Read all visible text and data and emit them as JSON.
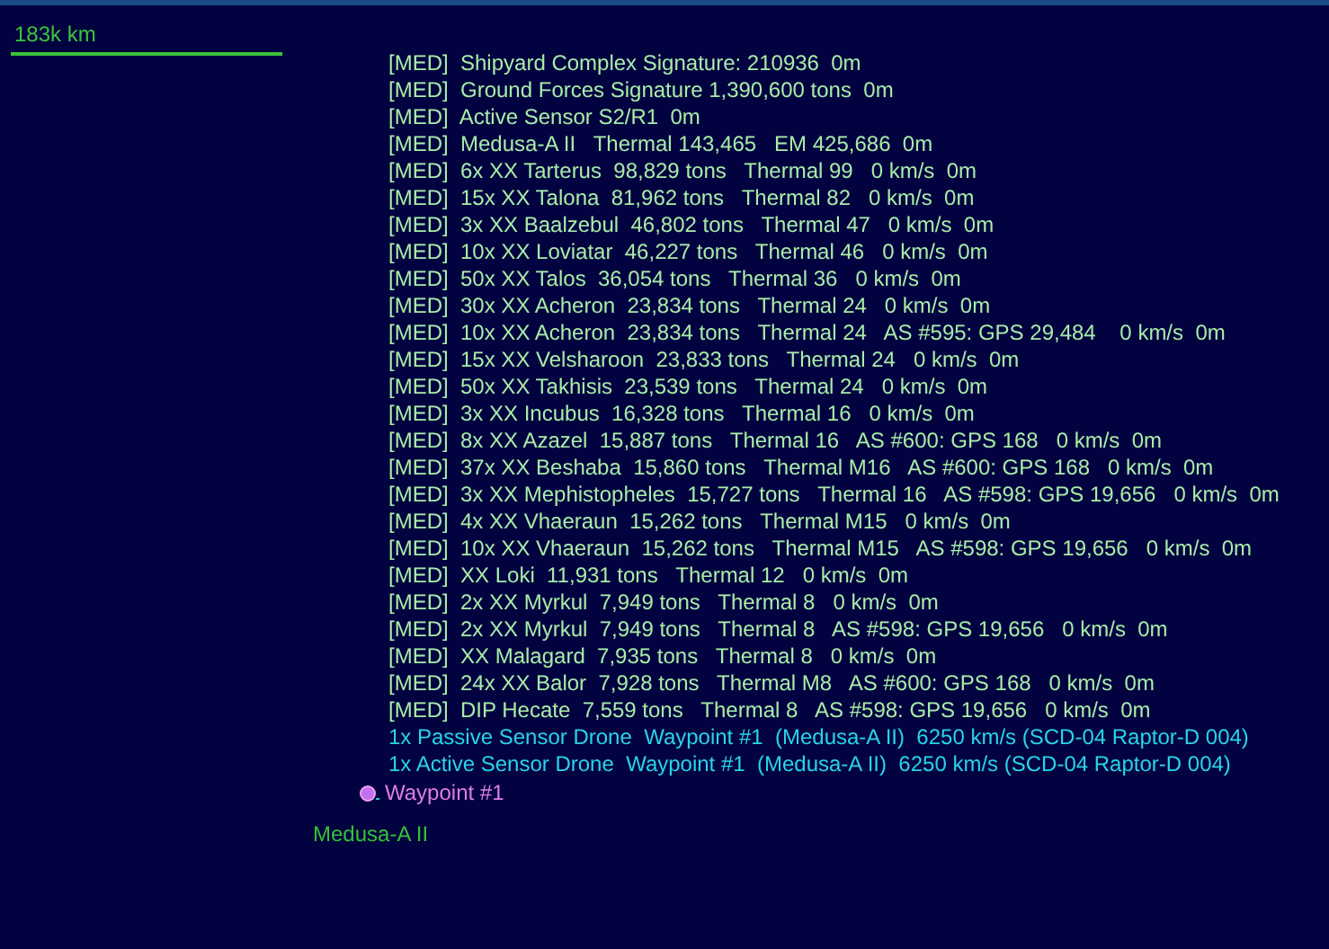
{
  "scale": {
    "label": "183k km"
  },
  "contacts": [
    {
      "kind": "contact",
      "text": "[MED]  Shipyard Complex Signature: 210936  0m"
    },
    {
      "kind": "contact",
      "text": "[MED]  Ground Forces Signature 1,390,600 tons  0m"
    },
    {
      "kind": "contact",
      "text": "[MED]  Active Sensor S2/R1  0m"
    },
    {
      "kind": "contact",
      "text": "[MED]  Medusa-A II   Thermal 143,465   EM 425,686  0m"
    },
    {
      "kind": "contact",
      "text": "[MED]  6x XX Tarterus  98,829 tons   Thermal 99   0 km/s  0m"
    },
    {
      "kind": "contact",
      "text": "[MED]  15x XX Talona  81,962 tons   Thermal 82   0 km/s  0m"
    },
    {
      "kind": "contact",
      "text": "[MED]  3x XX Baalzebul  46,802 tons   Thermal 47   0 km/s  0m"
    },
    {
      "kind": "contact",
      "text": "[MED]  10x XX Loviatar  46,227 tons   Thermal 46   0 km/s  0m"
    },
    {
      "kind": "contact",
      "text": "[MED]  50x XX Talos  36,054 tons   Thermal 36   0 km/s  0m"
    },
    {
      "kind": "contact",
      "text": "[MED]  30x XX Acheron  23,834 tons   Thermal 24   0 km/s  0m"
    },
    {
      "kind": "contact",
      "text": "[MED]  10x XX Acheron  23,834 tons   Thermal 24   AS #595: GPS 29,484    0 km/s  0m"
    },
    {
      "kind": "contact",
      "text": "[MED]  15x XX Velsharoon  23,833 tons   Thermal 24   0 km/s  0m"
    },
    {
      "kind": "contact",
      "text": "[MED]  50x XX Takhisis  23,539 tons   Thermal 24   0 km/s  0m"
    },
    {
      "kind": "contact",
      "text": "[MED]  3x XX Incubus  16,328 tons   Thermal 16   0 km/s  0m"
    },
    {
      "kind": "contact",
      "text": "[MED]  8x XX Azazel  15,887 tons   Thermal 16   AS #600: GPS 168   0 km/s  0m"
    },
    {
      "kind": "contact",
      "text": "[MED]  37x XX Beshaba  15,860 tons   Thermal M16   AS #600: GPS 168   0 km/s  0m"
    },
    {
      "kind": "contact",
      "text": "[MED]  3x XX Mephistopheles  15,727 tons   Thermal 16   AS #598: GPS 19,656   0 km/s  0m"
    },
    {
      "kind": "contact",
      "text": "[MED]  4x XX Vhaeraun  15,262 tons   Thermal M15   0 km/s  0m"
    },
    {
      "kind": "contact",
      "text": "[MED]  10x XX Vhaeraun  15,262 tons   Thermal M15   AS #598: GPS 19,656   0 km/s  0m"
    },
    {
      "kind": "contact",
      "text": "[MED]  XX Loki  11,931 tons   Thermal 12   0 km/s  0m"
    },
    {
      "kind": "contact",
      "text": "[MED]  2x XX Myrkul  7,949 tons   Thermal 8   0 km/s  0m"
    },
    {
      "kind": "contact",
      "text": "[MED]  2x XX Myrkul  7,949 tons   Thermal 8   AS #598: GPS 19,656   0 km/s  0m"
    },
    {
      "kind": "contact",
      "text": "[MED]  XX Malagard  7,935 tons   Thermal 8   0 km/s  0m"
    },
    {
      "kind": "contact",
      "text": "[MED]  24x XX Balor  7,928 tons   Thermal M8   AS #600: GPS 168   0 km/s  0m"
    },
    {
      "kind": "contact",
      "text": "[MED]  DIP Hecate  7,559 tons   Thermal 8   AS #598: GPS 19,656   0 km/s  0m"
    },
    {
      "kind": "drone",
      "text": "1x Passive Sensor Drone  Waypoint #1  (Medusa-A II)  6250 km/s (SCD-04 Raptor-D 004)"
    },
    {
      "kind": "drone",
      "text": "1x Active Sensor Drone  Waypoint #1  (Medusa-A II)  6250 km/s (SCD-04 Raptor-D 004)"
    }
  ],
  "waypoint": {
    "label": "Waypoint #1"
  },
  "body": {
    "label": "Medusa-A II"
  }
}
